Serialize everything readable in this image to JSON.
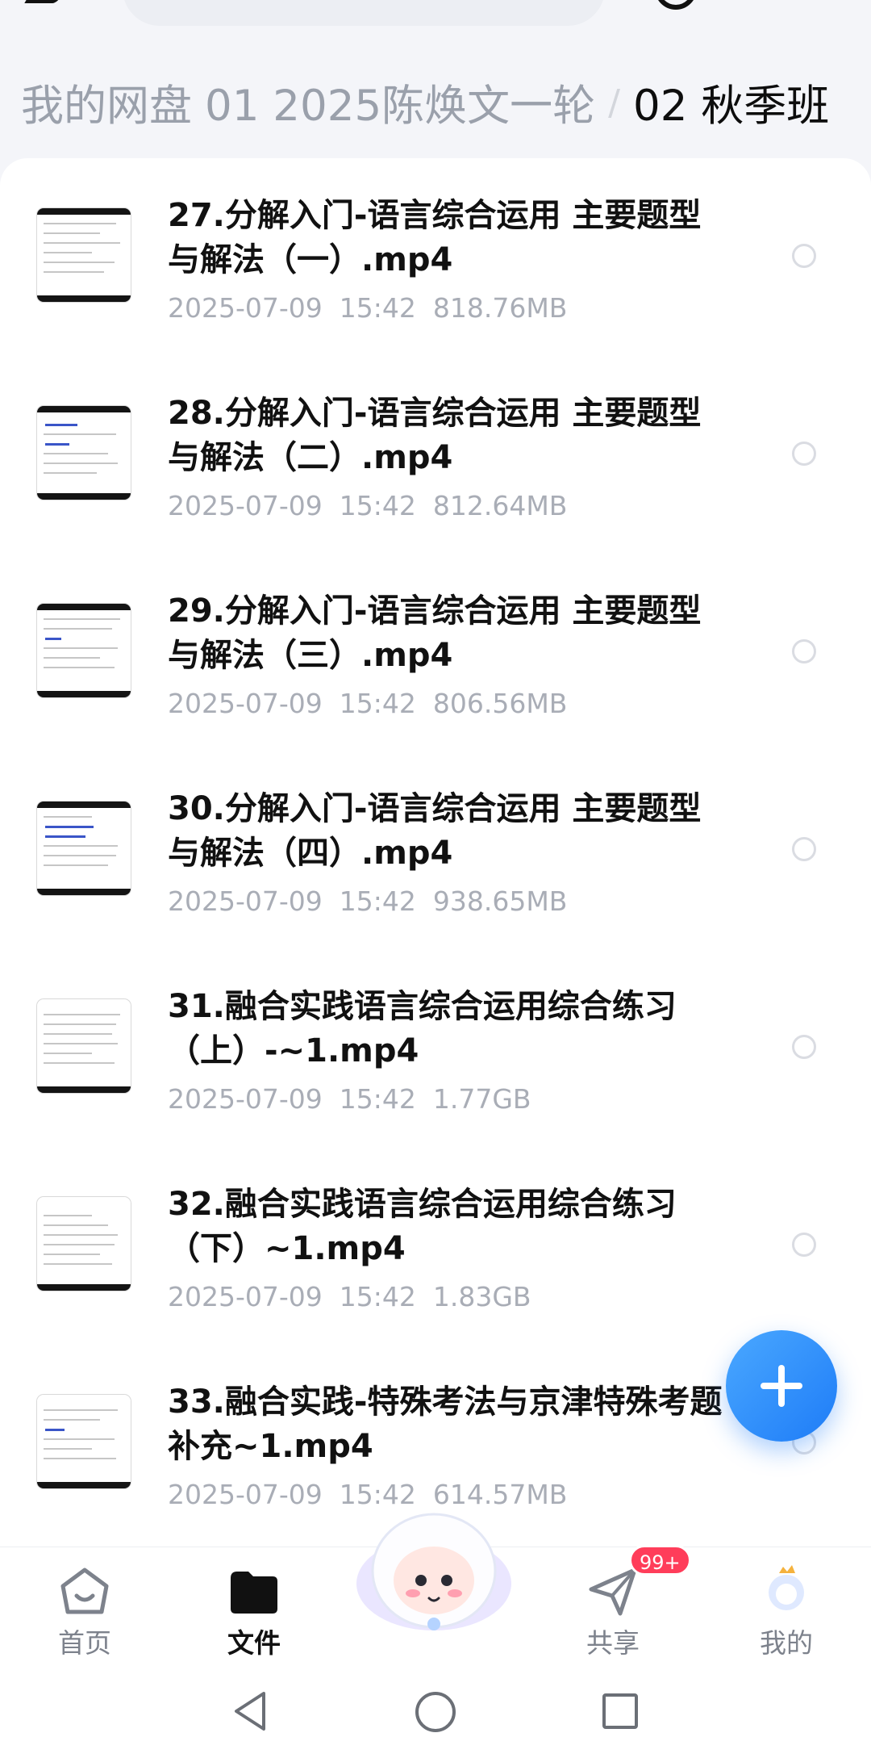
{
  "breadcrumb": {
    "items": [
      "我的网盘",
      "01 2025陈焕文一轮",
      "02 秋季班"
    ],
    "separator": "/"
  },
  "files": [
    {
      "name": "27.分解入门-语言综合运用 主要题型与解法（一）.mp4",
      "date": "2025-07-09",
      "time": "15:42",
      "size": "818.76MB"
    },
    {
      "name": "28.分解入门-语言综合运用 主要题型与解法（二）.mp4",
      "date": "2025-07-09",
      "time": "15:42",
      "size": "812.64MB"
    },
    {
      "name": "29.分解入门-语言综合运用 主要题型与解法（三）.mp4",
      "date": "2025-07-09",
      "time": "15:42",
      "size": "806.56MB"
    },
    {
      "name": "30.分解入门-语言综合运用 主要题型与解法（四）.mp4",
      "date": "2025-07-09",
      "time": "15:42",
      "size": "938.65MB"
    },
    {
      "name": "31.融合实践语言综合运用综合练习（上）-~1.mp4",
      "date": "2025-07-09",
      "time": "15:42",
      "size": "1.77GB"
    },
    {
      "name": "32.融合实践语言综合运用综合练习（下）~1.mp4",
      "date": "2025-07-09",
      "time": "15:42",
      "size": "1.83GB"
    },
    {
      "name": "33.融合实践-特殊考法与京津特殊考题补充~1.mp4",
      "date": "2025-07-09",
      "time": "15:42",
      "size": "614.57MB"
    }
  ],
  "tabs": [
    {
      "label": "首页",
      "icon": "home-icon"
    },
    {
      "label": "文件",
      "icon": "folder-icon",
      "active": true
    },
    {
      "label": "共享",
      "icon": "share-icon",
      "badge": "99+"
    },
    {
      "label": "我的",
      "icon": "profile-icon"
    }
  ],
  "colors": {
    "accent": "#1e7cf7",
    "badge": "#ff3d5a",
    "muted": "#a9adb6"
  }
}
